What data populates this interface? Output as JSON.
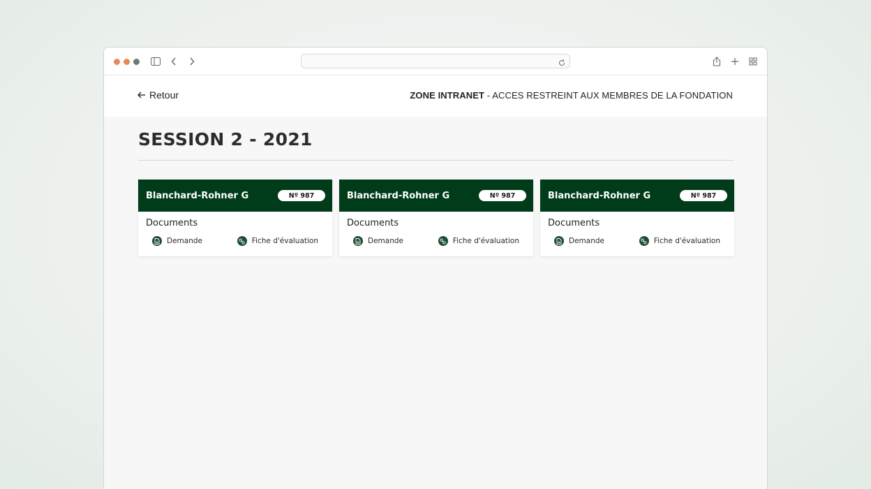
{
  "browser": {
    "traffic_lights": [
      "#e8895a",
      "#e8895a",
      "#6b7b72"
    ],
    "url": ""
  },
  "header": {
    "back_label": "Retour",
    "zone_bold": "ZONE INTRANET",
    "zone_rest": " - ACCES RESTREINT AUX MEMBRES DE LA FONDATION"
  },
  "page": {
    "title": "SESSION 2 - 2021"
  },
  "colors": {
    "card_header": "#003c19",
    "icon_bg": "#1e4d33"
  },
  "cards": [
    {
      "name": "Blanchard-Rohner G",
      "number": "Nº 987",
      "documents_label": "Documents",
      "links": [
        {
          "label": "Demande",
          "icon": "document-icon"
        },
        {
          "label": "Fiche d'évaluation",
          "icon": "evaluation-icon"
        }
      ]
    },
    {
      "name": "Blanchard-Rohner G",
      "number": "Nº 987",
      "documents_label": "Documents",
      "links": [
        {
          "label": "Demande",
          "icon": "document-icon"
        },
        {
          "label": "Fiche d'évaluation",
          "icon": "evaluation-icon"
        }
      ]
    },
    {
      "name": "Blanchard-Rohner G",
      "number": "Nº 987",
      "documents_label": "Documents",
      "links": [
        {
          "label": "Demande",
          "icon": "document-icon"
        },
        {
          "label": "Fiche d'évaluation",
          "icon": "evaluation-icon"
        }
      ]
    }
  ]
}
